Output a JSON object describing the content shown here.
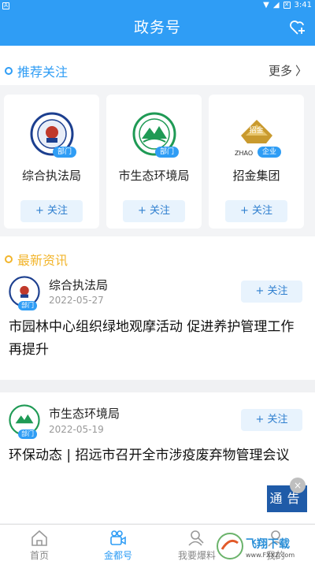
{
  "status_bar": {
    "left_glyph": "A",
    "time": "3:41",
    "battery_glyph": "✕"
  },
  "header": {
    "title": "政务号",
    "fav_icon": "heart-plus-icon"
  },
  "recommend": {
    "title": "推荐关注",
    "more": "更多",
    "cards": [
      {
        "name": "综合执法局",
        "badge": "部门",
        "follow": "+ 关注",
        "logo": "law-enforcement-emblem"
      },
      {
        "name": "市生态环境局",
        "badge": "部门",
        "follow": "+ 关注",
        "logo": "ecology-emblem"
      },
      {
        "name": "招金集团",
        "badge": "企业",
        "follow": "+ 关注",
        "logo": "zhaojin-logo",
        "logo_text": "招金",
        "logo_sub": "ZHAO"
      }
    ]
  },
  "news": {
    "title": "最新资讯",
    "items": [
      {
        "source": "综合执法局",
        "date": "2022-05-27",
        "badge": "部门",
        "follow": "+ 关注",
        "title": "市园林中心组织绿地观摩活动  促进养护管理工作再提升"
      },
      {
        "source": "市生态环境局",
        "date": "2022-05-19",
        "badge": "部门",
        "follow": "+ 关注",
        "title": "环保动态 | 招远市召开全市涉疫废弃物管理会议"
      }
    ]
  },
  "notice": {
    "label": "通告",
    "close": "×"
  },
  "tabs": [
    {
      "label": "首页",
      "icon": "home-icon",
      "active": false
    },
    {
      "label": "金都号",
      "icon": "video-camera-icon",
      "active": true
    },
    {
      "label": "我要爆料",
      "icon": "search-person-icon",
      "active": false
    },
    {
      "label": "我的",
      "icon": "user-icon",
      "active": false
    }
  ],
  "watermark": {
    "text": "飞翔下载",
    "sub": "www.FXXZ.com"
  },
  "colors": {
    "primary": "#2f9df5",
    "recommend_accent": "#2f9df5",
    "news_accent": "#f2b52c",
    "notice_bg": "#1f5ba8"
  }
}
